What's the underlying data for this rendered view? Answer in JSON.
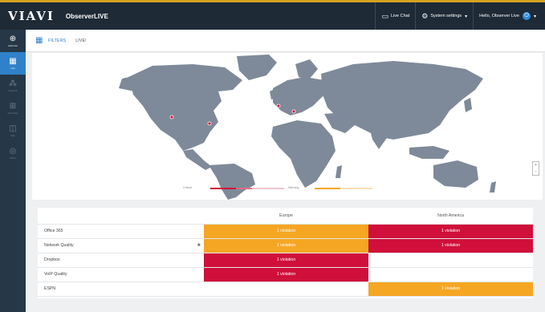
{
  "header": {
    "logo": "VIAVI",
    "app_name": "ObserverLIVE",
    "live_chat": "Live Chat",
    "system_settings": "System settings",
    "user_greeting": "Hello, Observer Live"
  },
  "sidebar": {
    "items": [
      {
        "label": "Add new",
        "icon": "plus-circle-icon"
      },
      {
        "label": "Live",
        "icon": "grid-icon"
      },
      {
        "label": "Network",
        "icon": "network-icon"
      },
      {
        "label": "Hierarchy",
        "icon": "hierarchy-icon"
      },
      {
        "label": "Map",
        "icon": "map-icon"
      },
      {
        "label": "Alerts",
        "icon": "alert-icon"
      }
    ]
  },
  "subbar": {
    "filters_label": "FILTERS",
    "live_label": "LIVE!"
  },
  "map": {
    "legend": {
      "critical": "Critical",
      "warning": "Warning"
    },
    "colors": {
      "critical": "#d0103a",
      "warning": "#f5a623",
      "land": "#7e8a99",
      "ocean": "#ffffff"
    }
  },
  "table": {
    "columns": [
      "",
      "Europe",
      "North America"
    ],
    "rows": [
      {
        "name": "Office 365",
        "europe": "1 violation",
        "europe_status": "warning",
        "na": "1 violation",
        "na_status": "critical"
      },
      {
        "name": "Network Quality",
        "europe": "1 violation",
        "europe_status": "warning",
        "na": "1 violation",
        "na_status": "critical",
        "marker": "✱"
      },
      {
        "name": "Dropbox",
        "europe": "1 violation",
        "europe_status": "critical",
        "na": "",
        "na_status": "none"
      },
      {
        "name": "VoIP Quality",
        "europe": "1 violation",
        "europe_status": "critical",
        "na": "",
        "na_status": "none"
      },
      {
        "name": "ESPN",
        "europe": "",
        "europe_status": "none",
        "na": "1 violation",
        "na_status": "warning"
      }
    ]
  }
}
